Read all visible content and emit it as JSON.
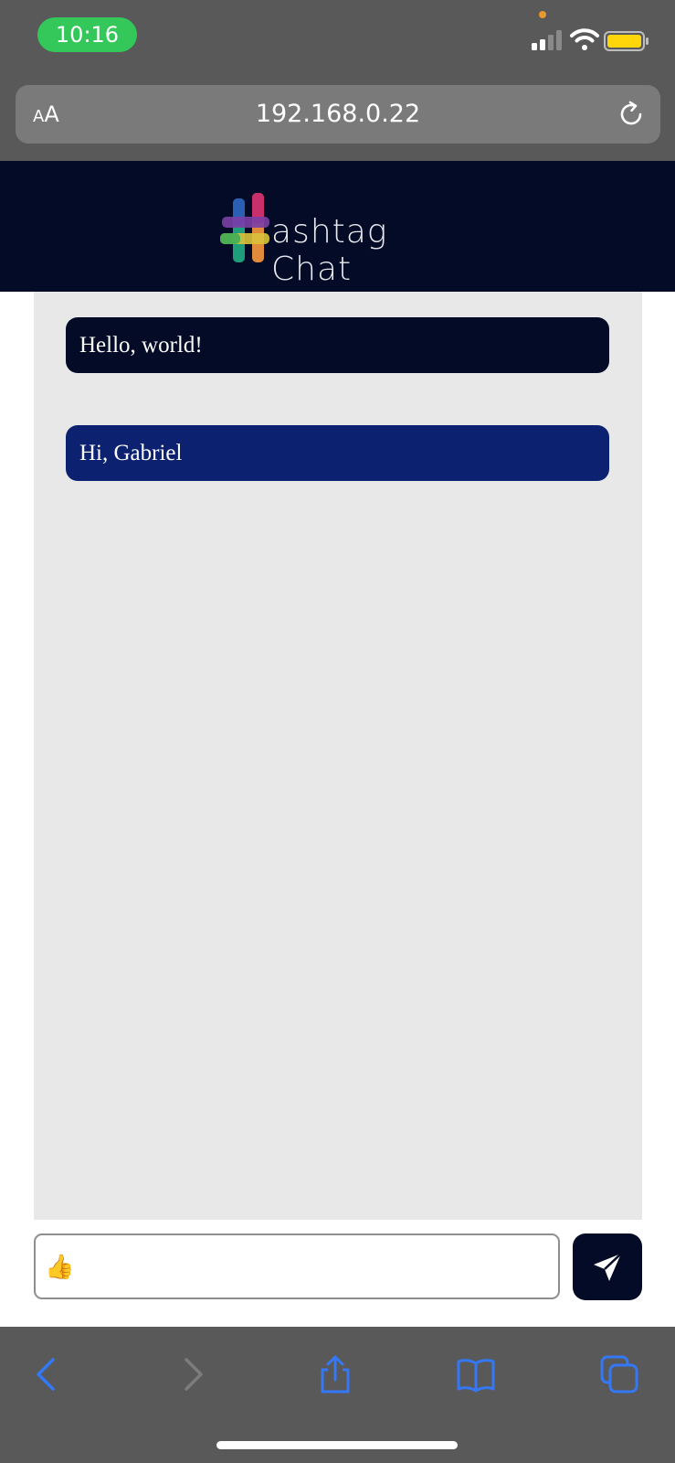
{
  "status_bar": {
    "time": "10:16"
  },
  "browser": {
    "aa_label_small": "A",
    "aa_label_large": "A",
    "url": "192.168.0.22"
  },
  "app": {
    "title": "ashtag Chat"
  },
  "messages": [
    {
      "text": "Hello, world!",
      "color": "#030b26"
    },
    {
      "text": "Hi, Gabriel",
      "color": "#0c2271"
    }
  ],
  "composer": {
    "value": "👍"
  },
  "colors": {
    "brand_dark": "#030b26",
    "brand_blue": "#0c2271",
    "ios_blue": "#3478f6",
    "status_green": "#34c759"
  },
  "toolbar_icons": [
    "back-icon",
    "forward-icon",
    "share-icon",
    "bookmarks-icon",
    "tabs-icon"
  ]
}
